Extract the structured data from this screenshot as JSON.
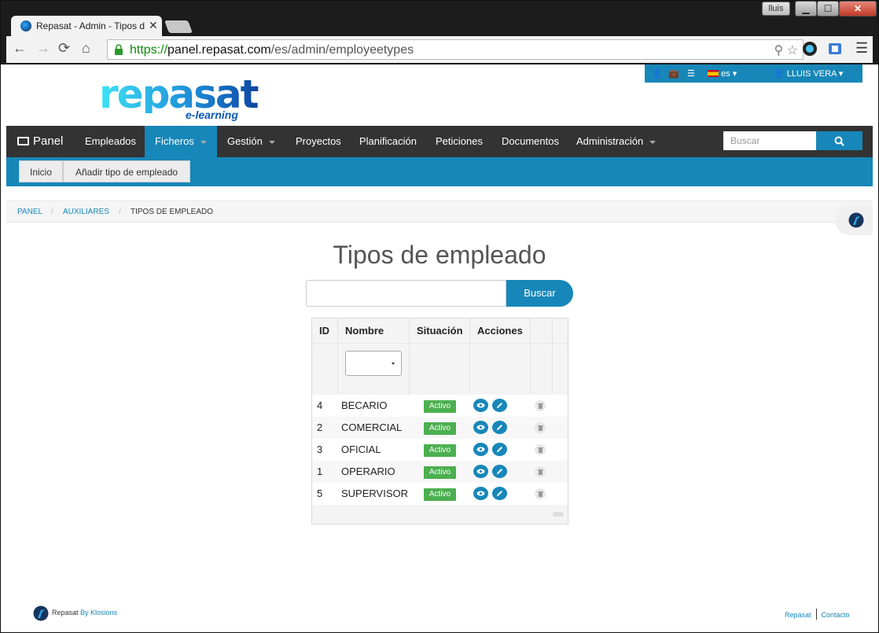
{
  "window": {
    "user_label": "lluis",
    "min": "▁",
    "max": "☐",
    "close": "✕"
  },
  "browser": {
    "tab_title": "Repasat - Admin - Tipos d",
    "url_scheme": "https://",
    "url_host": "panel.repasat.com",
    "url_path": "/es/admin/employeetypes"
  },
  "userbar": {
    "lang": "es",
    "user": "LLUIS VERA"
  },
  "logo": {
    "main": "repasat",
    "sub": "e-learning"
  },
  "nav": {
    "brand": "Panel",
    "items": [
      {
        "label": "Empleados"
      },
      {
        "label": "Ficheros"
      },
      {
        "label": "Gestión"
      },
      {
        "label": "Proyectos"
      },
      {
        "label": "Planificación"
      },
      {
        "label": "Peticiones"
      },
      {
        "label": "Documentos"
      },
      {
        "label": "Administración"
      }
    ],
    "search_placeholder": "Buscar"
  },
  "subnav": {
    "home": "Inicio",
    "add": "Añadir tipo de empleado"
  },
  "breadcrumb": [
    "PANEL",
    "AUXILIARES",
    "TIPOS DE EMPLEADO"
  ],
  "main": {
    "title": "Tipos de empleado",
    "search_value": "",
    "search_button": "Buscar"
  },
  "table": {
    "headers": [
      "ID",
      "Nombre",
      "Situación",
      "Acciones"
    ],
    "rows": [
      {
        "id": "4",
        "name": "BECARIO",
        "status": "Activo"
      },
      {
        "id": "2",
        "name": "COMERCIAL",
        "status": "Activo"
      },
      {
        "id": "3",
        "name": "OFICIAL",
        "status": "Activo"
      },
      {
        "id": "1",
        "name": "OPERARIO",
        "status": "Activo"
      },
      {
        "id": "5",
        "name": "SUPERVISOR",
        "status": "Activo"
      }
    ]
  },
  "footer": {
    "brand": "Repasat",
    "by": "By Klosions",
    "link1": "Repasat",
    "link2": "Contacto"
  }
}
